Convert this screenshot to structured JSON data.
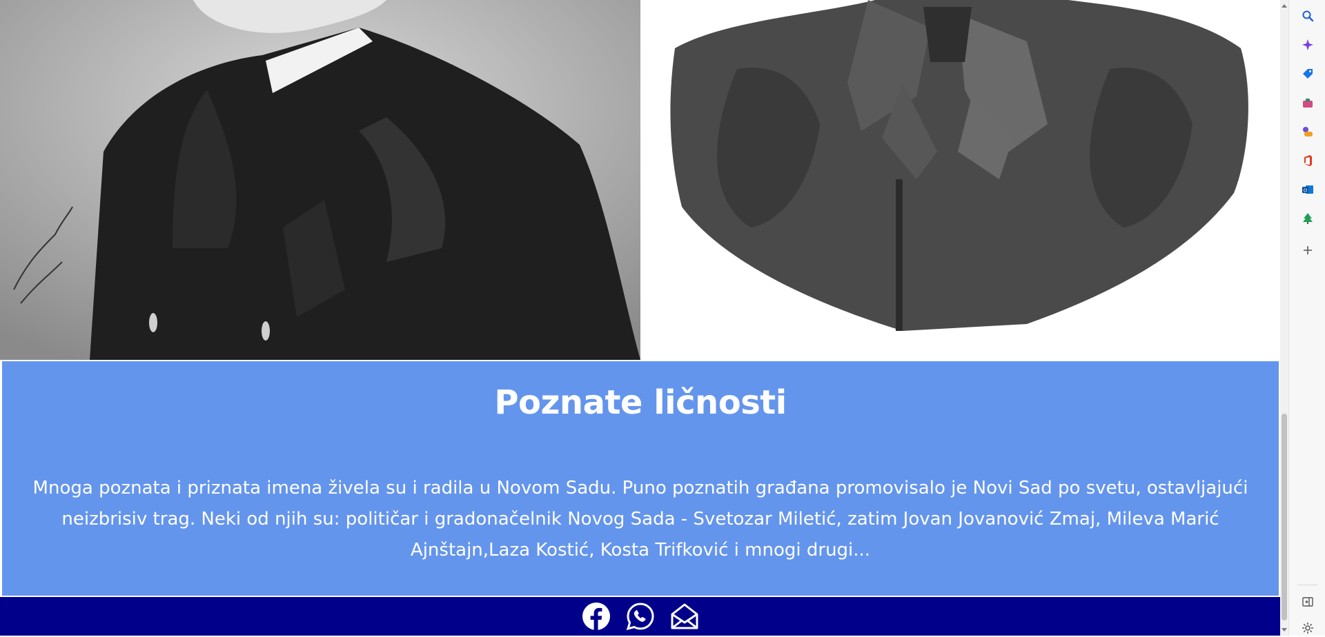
{
  "section": {
    "title": "Poznate ličnosti",
    "text": "Mnoga poznata i priznata imena živela su i radila u Novom Sadu. Puno poznatih građana promovisalo je Novi Sad po svetu, ostavljajući neizbrisiv trag. Neki od njih su: političar i gradonačelnik Novog Sada - Svetozar Miletić, zatim Jovan Jovanović Zmaj, Mileva Marić Ajnštajn,Laza Kostić, Kosta Trifković i mnogi drugi..."
  },
  "footer": {
    "icons": [
      "facebook-icon",
      "whatsapp-icon",
      "mail-icon"
    ]
  },
  "sidebar": {
    "icons": [
      "search-icon",
      "copilot-icon",
      "shopping-tag-icon",
      "tools-icon",
      "games-icon",
      "office-icon",
      "outlook-icon",
      "tree-icon",
      "add-icon",
      "split-screen-icon",
      "settings-icon"
    ]
  },
  "colors": {
    "section_bg": "#6495ed",
    "footer_bg": "#00008b",
    "text": "#ffffff"
  }
}
